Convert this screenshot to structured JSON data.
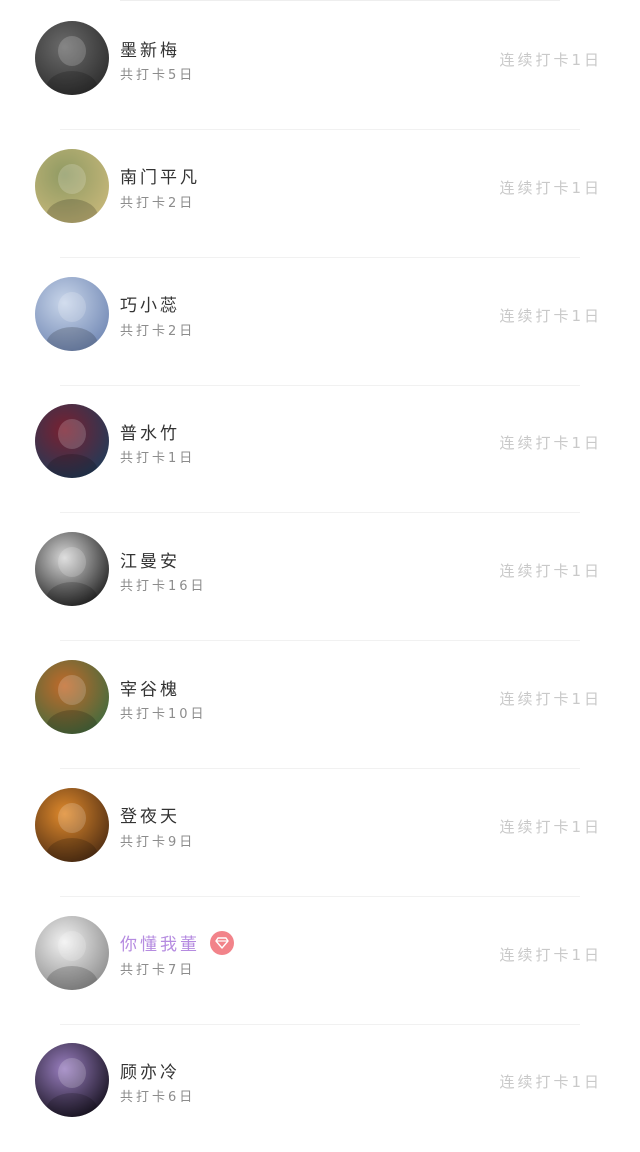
{
  "members": [
    {
      "name": "墨新梅",
      "total": "共打卡5日",
      "streak": "连续打卡1日",
      "vip": false,
      "avatar_colors": [
        "#6b6b6b",
        "#2b2b2b"
      ]
    },
    {
      "name": "南门平凡",
      "total": "共打卡2日",
      "streak": "连续打卡1日",
      "vip": false,
      "avatar_colors": [
        "#8f9a63",
        "#c8b87a"
      ]
    },
    {
      "name": "巧小蕊",
      "total": "共打卡2日",
      "streak": "连续打卡1日",
      "vip": false,
      "avatar_colors": [
        "#c9d6ea",
        "#6f86b3"
      ]
    },
    {
      "name": "普水竹",
      "total": "共打卡1日",
      "streak": "连续打卡1日",
      "vip": false,
      "avatar_colors": [
        "#7a2030",
        "#1d3c5a"
      ]
    },
    {
      "name": "江曼安",
      "total": "共打卡16日",
      "streak": "连续打卡1日",
      "vip": false,
      "avatar_colors": [
        "#d8d8d8",
        "#1a1a1a"
      ]
    },
    {
      "name": "宰谷槐",
      "total": "共打卡10日",
      "streak": "连续打卡1日",
      "vip": false,
      "avatar_colors": [
        "#c26a2a",
        "#3d6b3f"
      ]
    },
    {
      "name": "登夜天",
      "total": "共打卡9日",
      "streak": "连续打卡1日",
      "vip": false,
      "avatar_colors": [
        "#e08a2c",
        "#4a2a12"
      ]
    },
    {
      "name": "你懂我董",
      "total": "共打卡7日",
      "streak": "连续打卡1日",
      "vip": true,
      "avatar_colors": [
        "#f2f2f2",
        "#8a8a8a"
      ]
    },
    {
      "name": "顾亦冷",
      "total": "共打卡6日",
      "streak": "连续打卡1日",
      "vip": false,
      "avatar_colors": [
        "#9a7fc0",
        "#120e1a"
      ]
    }
  ],
  "icons": {
    "vip_badge": "diamond-icon",
    "vip_badge_color": "#f2838a",
    "vip_name_color": "#b58be0"
  }
}
